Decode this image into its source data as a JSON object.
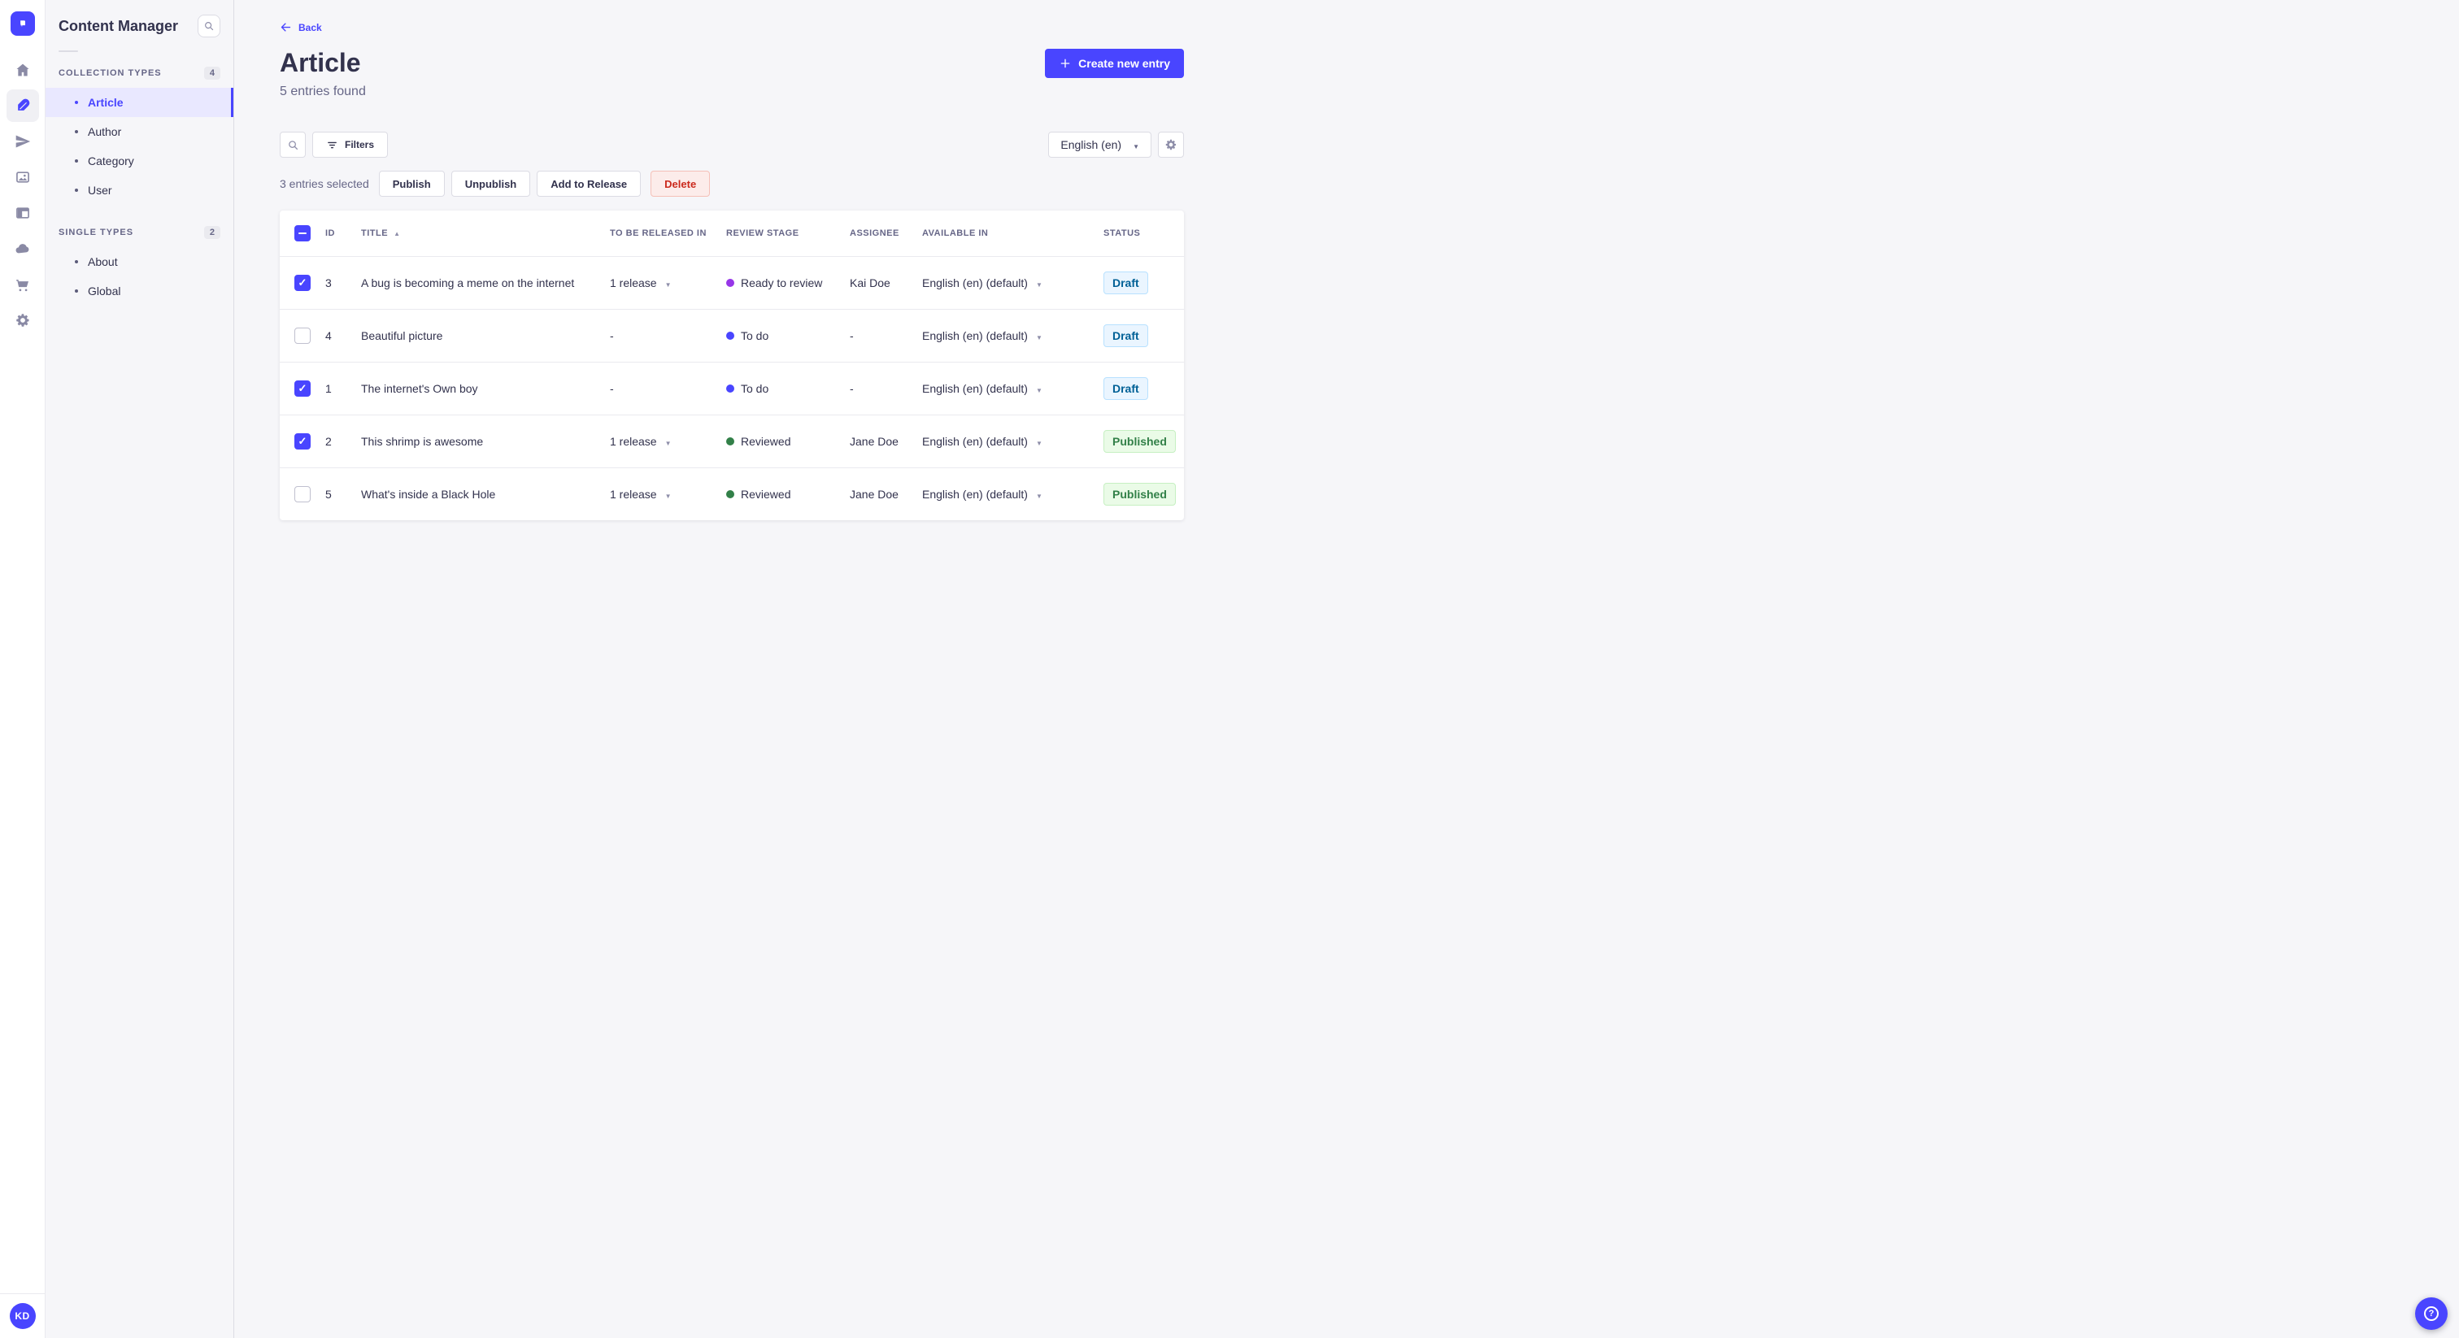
{
  "colors": {
    "primary": "#4945ff",
    "text": "#32324d",
    "subtext": "#666687",
    "border": "#dcdce4",
    "background": "#f6f6f9",
    "active_item_bg": "#e9e8ff",
    "draft_bg": "#eaf5ff",
    "draft_border": "#b8e1ff",
    "draft_text": "#006096",
    "published_bg": "#eafbe7",
    "published_border": "#c6f0c2",
    "published_text": "#328048",
    "danger_bg": "#fcecea",
    "danger_border": "#f5c0b8",
    "danger_text": "#cb2a1d",
    "stage_purple": "#9736e8",
    "stage_blue": "#4945ff",
    "stage_green": "#328048"
  },
  "rail": {
    "logo_icon": "strapi-logo",
    "items": [
      {
        "icon": "home-icon",
        "active": false
      },
      {
        "icon": "feather-icon",
        "active": true
      },
      {
        "icon": "paper-plane-icon",
        "active": false
      },
      {
        "icon": "images-icon",
        "active": false
      },
      {
        "icon": "layout-icon",
        "active": false
      },
      {
        "icon": "cloud-icon",
        "active": false
      },
      {
        "icon": "cart-icon",
        "active": false
      },
      {
        "icon": "gear-icon",
        "active": false
      }
    ],
    "avatar_initials": "KD"
  },
  "subnav": {
    "title": "Content Manager",
    "sections": [
      {
        "label": "COLLECTION TYPES",
        "badge": "4",
        "items": [
          {
            "label": "Article",
            "active": true
          },
          {
            "label": "Author"
          },
          {
            "label": "Category"
          },
          {
            "label": "User"
          }
        ]
      },
      {
        "label": "SINGLE TYPES",
        "badge": "2",
        "items": [
          {
            "label": "About"
          },
          {
            "label": "Global"
          }
        ]
      }
    ]
  },
  "header": {
    "back_label": "Back",
    "title": "Article",
    "subtitle": "5 entries found",
    "create_label": "Create new entry"
  },
  "toolbar": {
    "filters_label": "Filters",
    "locale_value": "English (en)"
  },
  "selection": {
    "count_text": "3 entries selected",
    "publish_label": "Publish",
    "unpublish_label": "Unpublish",
    "add_to_release_label": "Add to Release",
    "delete_label": "Delete"
  },
  "table": {
    "select_all_state": "indeterminate",
    "sort_column": "TITLE",
    "sort_direction": "asc",
    "columns": {
      "id": "ID",
      "title": "TITLE",
      "release": "TO BE RELEASED IN",
      "stage": "REVIEW STAGE",
      "assignee": "ASSIGNEE",
      "available": "AVAILABLE IN",
      "status": "STATUS"
    },
    "rows": [
      {
        "checkbox": "checked",
        "id": "3",
        "title": "A bug is becoming a meme on the internet",
        "release": "1 release",
        "release_caret": true,
        "stage": "Ready to review",
        "stage_variant": "purple",
        "assignee": "Kai Doe",
        "available": "English (en) (default)",
        "status": "Draft",
        "status_variant": "draft"
      },
      {
        "checkbox": "unchecked",
        "id": "4",
        "title": "Beautiful picture",
        "release": "-",
        "release_caret": false,
        "stage": "To do",
        "stage_variant": "blue",
        "assignee": "-",
        "available": "English (en) (default)",
        "status": "Draft",
        "status_variant": "draft"
      },
      {
        "checkbox": "checked",
        "id": "1",
        "title": "The internet's Own boy",
        "release": "-",
        "release_caret": false,
        "stage": "To do",
        "stage_variant": "blue",
        "assignee": "-",
        "available": "English (en) (default)",
        "status": "Draft",
        "status_variant": "draft"
      },
      {
        "checkbox": "checked",
        "id": "2",
        "title": "This shrimp is awesome",
        "release": "1 release",
        "release_caret": true,
        "stage": "Reviewed",
        "stage_variant": "green",
        "assignee": "Jane Doe",
        "available": "English (en) (default)",
        "status": "Published",
        "status_variant": "published"
      },
      {
        "checkbox": "unchecked",
        "id": "5",
        "title": "What's inside a Black Hole",
        "release": "1 release",
        "release_caret": true,
        "stage": "Reviewed",
        "stage_variant": "green",
        "assignee": "Jane Doe",
        "available": "English (en) (default)",
        "status": "Published",
        "status_variant": "published"
      }
    ]
  },
  "fab": {
    "help_glyph": "?"
  }
}
